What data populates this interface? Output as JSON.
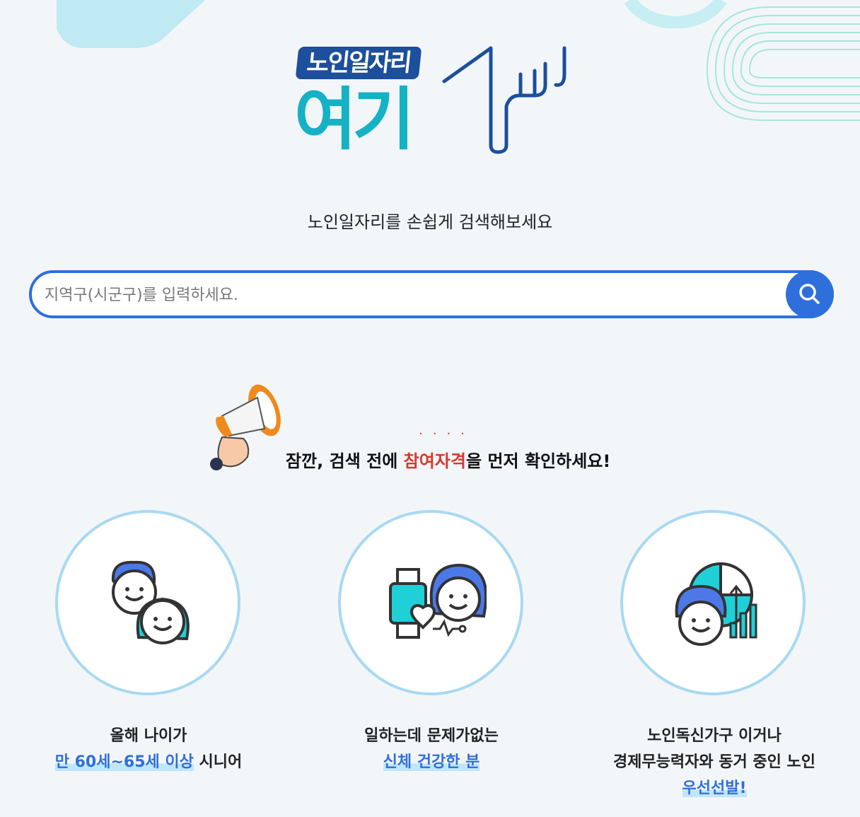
{
  "logo": {
    "tag": "노인일자리",
    "main": "여기"
  },
  "subtitle": "노인일자리를 손쉽게 검색해보세요",
  "search": {
    "placeholder": "지역구(시군구)를 입력하세요."
  },
  "notice": {
    "dots": "....",
    "prefix": "잠깐, 검색 전에 ",
    "highlight": "참여자격",
    "suffix": "을 먼저 확인하세요!"
  },
  "criteria": [
    {
      "icon": "senior-couple-icon",
      "line1": "올해 나이가",
      "highlight": "만 60세~65세 이상",
      "after": " 시니어"
    },
    {
      "icon": "smartwatch-health-icon",
      "line1": "일하는데 문제가없는",
      "highlight": "신체 건강한 분"
    },
    {
      "icon": "senior-chart-icon",
      "line1": "노인독신가구 이거나",
      "line2": "경제무능력자와 동거 중인 노인",
      "highlight": "우선선발!"
    }
  ],
  "colors": {
    "primary": "#2f6fdb",
    "accent_red": "#d33a2c",
    "logo_teal": "#14b2c4",
    "logo_navy": "#1c4f9c",
    "circle_border": "#a8d9f2"
  }
}
